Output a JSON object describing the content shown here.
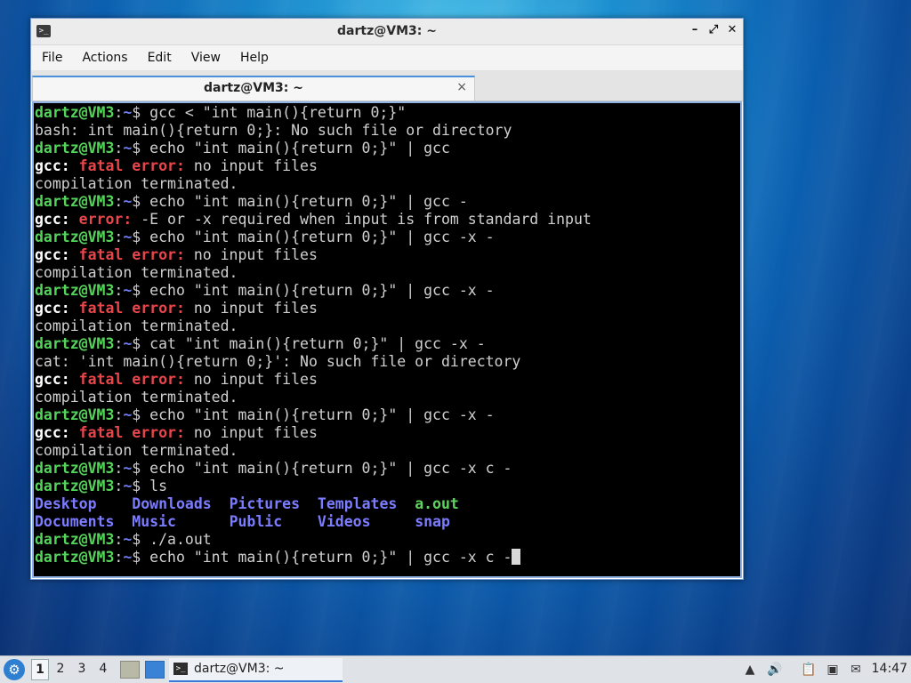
{
  "window": {
    "title": "dartz@VM3: ~",
    "controls": [
      "–",
      "⤢",
      "✕"
    ]
  },
  "menu": [
    "File",
    "Actions",
    "Edit",
    "View",
    "Help"
  ],
  "tab": {
    "label": "dartz@VM3: ~",
    "close": "×"
  },
  "terminal": {
    "lines": [
      [
        {
          "t": "dartz@VM3",
          "c": "prompt"
        },
        {
          "t": ":",
          "c": "cmd"
        },
        {
          "t": "~",
          "c": "path"
        },
        {
          "t": "$ gcc < \"int main(){return 0;}\"",
          "c": "cmd"
        }
      ],
      [
        {
          "t": "bash: int main(){return 0;}: No such file or directory",
          "c": "cmd"
        }
      ],
      [
        {
          "t": "dartz@VM3",
          "c": "prompt"
        },
        {
          "t": ":",
          "c": "cmd"
        },
        {
          "t": "~",
          "c": "path"
        },
        {
          "t": "$ echo \"int main(){return 0;}\" | gcc",
          "c": "cmd"
        }
      ],
      [
        {
          "t": "gcc: ",
          "c": "bold"
        },
        {
          "t": "fatal error: ",
          "c": "fatal"
        },
        {
          "t": "no input files",
          "c": "cmd"
        }
      ],
      [
        {
          "t": "compilation terminated.",
          "c": "cmd"
        }
      ],
      [
        {
          "t": "dartz@VM3",
          "c": "prompt"
        },
        {
          "t": ":",
          "c": "cmd"
        },
        {
          "t": "~",
          "c": "path"
        },
        {
          "t": "$ echo \"int main(){return 0;}\" | gcc -",
          "c": "cmd"
        }
      ],
      [
        {
          "t": "gcc: ",
          "c": "bold"
        },
        {
          "t": "error: ",
          "c": "fatal"
        },
        {
          "t": "-E or -x required when input is from standard input",
          "c": "cmd"
        }
      ],
      [
        {
          "t": "dartz@VM3",
          "c": "prompt"
        },
        {
          "t": ":",
          "c": "cmd"
        },
        {
          "t": "~",
          "c": "path"
        },
        {
          "t": "$ echo \"int main(){return 0;}\" | gcc -x -",
          "c": "cmd"
        }
      ],
      [
        {
          "t": "gcc: ",
          "c": "bold"
        },
        {
          "t": "fatal error: ",
          "c": "fatal"
        },
        {
          "t": "no input files",
          "c": "cmd"
        }
      ],
      [
        {
          "t": "compilation terminated.",
          "c": "cmd"
        }
      ],
      [
        {
          "t": "dartz@VM3",
          "c": "prompt"
        },
        {
          "t": ":",
          "c": "cmd"
        },
        {
          "t": "~",
          "c": "path"
        },
        {
          "t": "$ echo \"int main(){return 0;}\" | gcc -x -",
          "c": "cmd"
        }
      ],
      [
        {
          "t": "gcc: ",
          "c": "bold"
        },
        {
          "t": "fatal error: ",
          "c": "fatal"
        },
        {
          "t": "no input files",
          "c": "cmd"
        }
      ],
      [
        {
          "t": "compilation terminated.",
          "c": "cmd"
        }
      ],
      [
        {
          "t": "dartz@VM3",
          "c": "prompt"
        },
        {
          "t": ":",
          "c": "cmd"
        },
        {
          "t": "~",
          "c": "path"
        },
        {
          "t": "$ cat \"int main(){return 0;}\" | gcc -x -",
          "c": "cmd"
        }
      ],
      [
        {
          "t": "cat: 'int main(){return 0;}': No such file or directory",
          "c": "cmd"
        }
      ],
      [
        {
          "t": "gcc: ",
          "c": "bold"
        },
        {
          "t": "fatal error: ",
          "c": "fatal"
        },
        {
          "t": "no input files",
          "c": "cmd"
        }
      ],
      [
        {
          "t": "compilation terminated.",
          "c": "cmd"
        }
      ],
      [
        {
          "t": "dartz@VM3",
          "c": "prompt"
        },
        {
          "t": ":",
          "c": "cmd"
        },
        {
          "t": "~",
          "c": "path"
        },
        {
          "t": "$ echo \"int main(){return 0;}\" | gcc -x -",
          "c": "cmd"
        }
      ],
      [
        {
          "t": "gcc: ",
          "c": "bold"
        },
        {
          "t": "fatal error: ",
          "c": "fatal"
        },
        {
          "t": "no input files",
          "c": "cmd"
        }
      ],
      [
        {
          "t": "compilation terminated.",
          "c": "cmd"
        }
      ],
      [
        {
          "t": "dartz@VM3",
          "c": "prompt"
        },
        {
          "t": ":",
          "c": "cmd"
        },
        {
          "t": "~",
          "c": "path"
        },
        {
          "t": "$ echo \"int main(){return 0;}\" | gcc -x c -",
          "c": "cmd"
        }
      ],
      [
        {
          "t": "dartz@VM3",
          "c": "prompt"
        },
        {
          "t": ":",
          "c": "cmd"
        },
        {
          "t": "~",
          "c": "path"
        },
        {
          "t": "$ ls",
          "c": "cmd"
        }
      ],
      [
        {
          "t": "Desktop    ",
          "c": "dir"
        },
        {
          "t": "Downloads  ",
          "c": "dir"
        },
        {
          "t": "Pictures  ",
          "c": "dir"
        },
        {
          "t": "Templates  ",
          "c": "dir"
        },
        {
          "t": "a.out",
          "c": "exe"
        }
      ],
      [
        {
          "t": "Documents  ",
          "c": "dir"
        },
        {
          "t": "Music      ",
          "c": "dir"
        },
        {
          "t": "Public    ",
          "c": "dir"
        },
        {
          "t": "Videos     ",
          "c": "dir"
        },
        {
          "t": "snap",
          "c": "dir"
        }
      ],
      [
        {
          "t": "dartz@VM3",
          "c": "prompt"
        },
        {
          "t": ":",
          "c": "cmd"
        },
        {
          "t": "~",
          "c": "path"
        },
        {
          "t": "$ ./a.out",
          "c": "cmd"
        }
      ],
      [
        {
          "t": "dartz@VM3",
          "c": "prompt"
        },
        {
          "t": ":",
          "c": "cmd"
        },
        {
          "t": "~",
          "c": "path"
        },
        {
          "t": "$ echo \"int main(){return 0;}\" | gcc -x c -",
          "c": "cmd"
        },
        {
          "t": "",
          "c": "cursor"
        }
      ]
    ]
  },
  "taskbar": {
    "workspaces": [
      "1",
      "2",
      "3",
      "4"
    ],
    "active_workspace": "1",
    "task_label": "dartz@VM3: ~",
    "clock": "14:47"
  }
}
